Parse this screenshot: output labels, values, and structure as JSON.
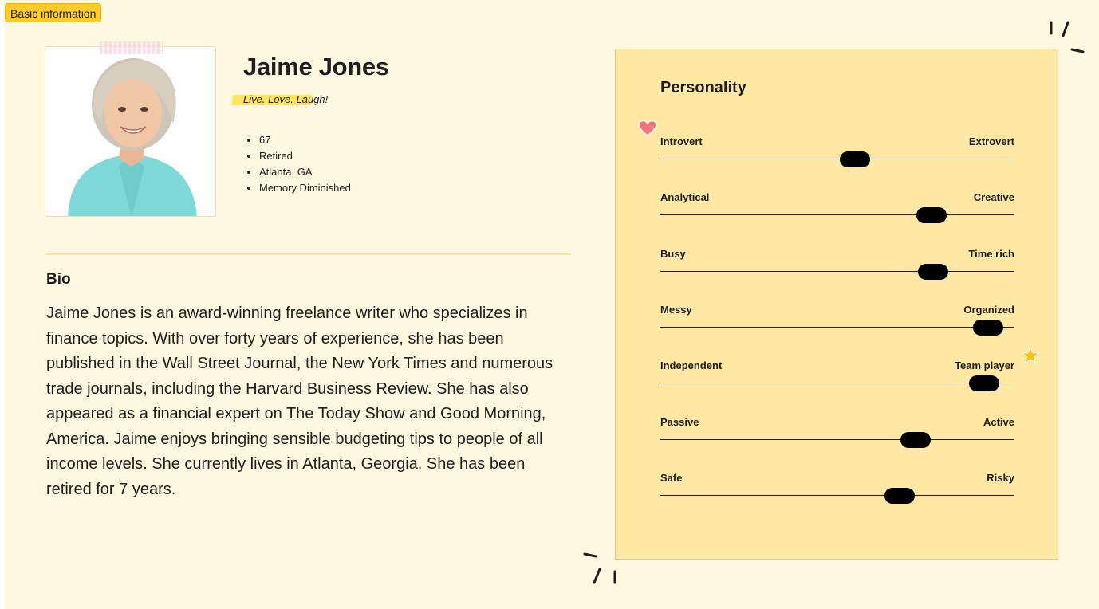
{
  "badge": "Basic information",
  "profile": {
    "name": "Jaime Jones",
    "motto": "Live. Love. Laugh!",
    "facts": [
      "67",
      "Retired",
      "Atlanta, GA",
      "Memory Diminished"
    ]
  },
  "bio": {
    "title": "Bio",
    "text": "Jaime Jones is an award-winning freelance writer who specializes in finance topics. With over forty years of experience, she has been published in the Wall Street Journal, the New York Times and numerous trade journals, including the Harvard Business Review. She has also appeared as a financial expert on The Today Show and Good Morning, America. Jaime enjoys bringing sensible budgeting tips to people of all income levels. She currently lives in Atlanta, Georgia. She has been retired for 7 years."
  },
  "personality": {
    "title": "Personality",
    "traits": [
      {
        "left": "Introvert",
        "right": "Extrovert",
        "value": 0.55
      },
      {
        "left": "Analytical",
        "right": "Creative",
        "value": 0.765
      },
      {
        "left": "Busy",
        "right": "Time rich",
        "value": 0.77
      },
      {
        "left": "Messy",
        "right": "Organized",
        "value": 0.925
      },
      {
        "left": "Independent",
        "right": "Team player",
        "value": 0.915
      },
      {
        "left": "Passive",
        "right": "Active",
        "value": 0.72
      },
      {
        "left": "Safe",
        "right": "Risky",
        "value": 0.675
      }
    ]
  },
  "colors": {
    "badge": "#ffcd29",
    "panel": "#ffe8a3",
    "canvas": "#fff7df",
    "heart": "#f2767a",
    "star": "#ffc21a"
  },
  "icons": [
    "heart-icon",
    "star-icon",
    "sparkle-icon"
  ]
}
